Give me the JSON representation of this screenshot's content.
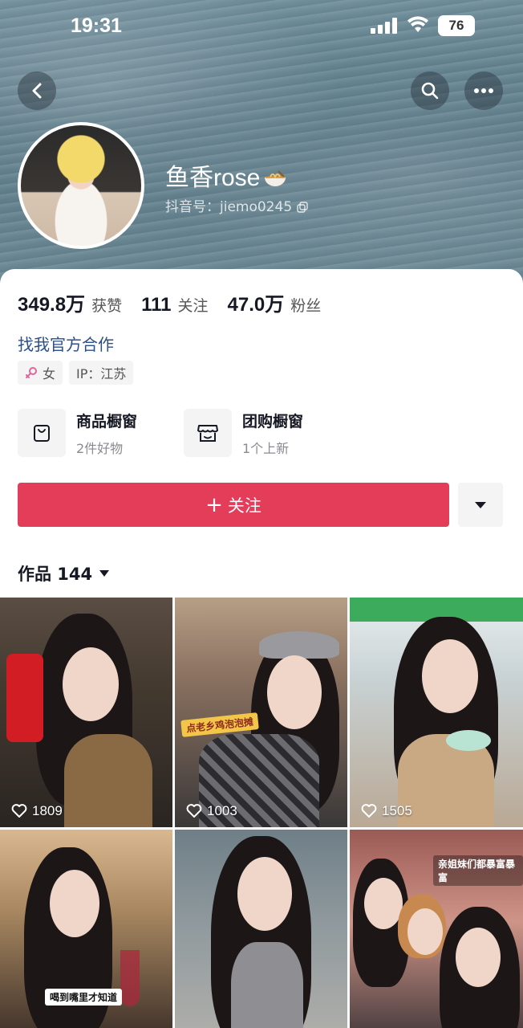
{
  "status_bar": {
    "time": "19:31",
    "battery": "76"
  },
  "profile": {
    "name": "鱼香rose",
    "douyin_id_label": "抖音号：",
    "douyin_id": "jiemo0245"
  },
  "stats": [
    {
      "value": "349.8万",
      "label": "获赞"
    },
    {
      "value": "111",
      "label": "关注"
    },
    {
      "value": "47.0万",
      "label": "粉丝"
    }
  ],
  "cooperation_link": "找我官方合作",
  "tags": {
    "gender": "女",
    "ip": "IP：江苏"
  },
  "shops": [
    {
      "title": "商品橱窗",
      "subtitle": "2件好物",
      "icon": "shopping-bag-icon"
    },
    {
      "title": "团购橱窗",
      "subtitle": "1个上新",
      "icon": "storefront-icon"
    }
  ],
  "follow_button": {
    "plus": "+",
    "label": "关注"
  },
  "works": {
    "label": "作品 144"
  },
  "videos": [
    {
      "likes": "1809",
      "caption": ""
    },
    {
      "likes": "1003",
      "caption": "点老乡鸡泡泡摊"
    },
    {
      "likes": "1505",
      "caption": ""
    },
    {
      "likes": "",
      "caption": "喝到嘴里才知道"
    },
    {
      "likes": "",
      "caption": ""
    },
    {
      "likes": "",
      "caption": "亲姐妹们都暴富暴富"
    }
  ],
  "colors": {
    "follow_button": "#e33d5a",
    "link": "#2b4e8c"
  }
}
